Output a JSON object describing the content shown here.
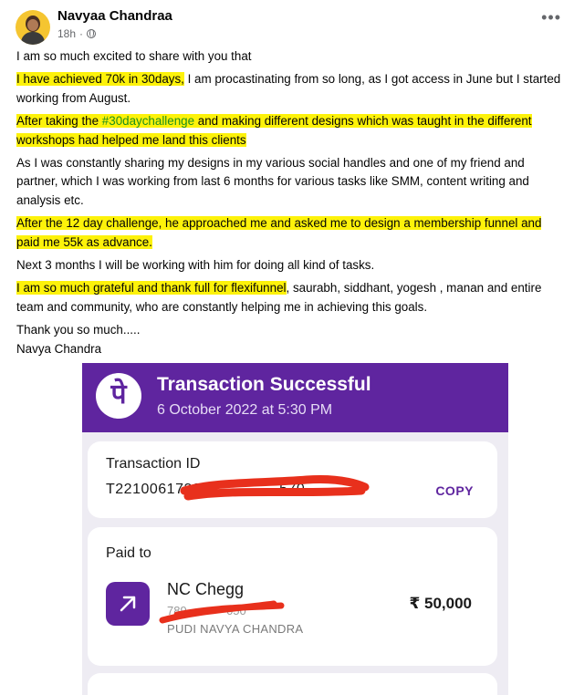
{
  "post": {
    "author": "Navyaa Chandraa",
    "time": "18h",
    "dot": "·",
    "more": "•••",
    "p1": "I am so much excited to share with you that",
    "p2_highlight": "I have achieved 70k in 30days,",
    "p2_rest": " I am procastinating from so long, as I got access in June but I started working from August.",
    "p3_a": "After taking the ",
    "p3_tag": "#30daychallenge",
    "p3_b": " and making different designs which was taught in the different workshops had helped me land this clients",
    "p4": "As I was constantly sharing my designs in my various social handles and one of my friend and partner, which I was working from last 6 months for various tasks like SMM, content writing and analysis etc.",
    "p5": "After the 12 day challenge, he approached me and asked me to design a membership funnel and paid me 55k as advance.",
    "p6": "Next 3 months I will be working with him for doing all kind of tasks.",
    "p7_highlight": "I am so much grateful and thank full for flexifunnel",
    "p7_rest": ", saurabh, siddhant, yogesh , manan and entire team and community, who are constantly helping me in achieving this goals.",
    "p8": "Thank you so much.....",
    "p9": "Navya Chandra"
  },
  "payment": {
    "logo": "पे",
    "title": "Transaction Successful",
    "date": "6 October 2022 at 5:30 PM",
    "txn_label": "Transaction ID",
    "txn_id_visible": "T221006173030",
    "txn_id_tail": "570",
    "copy": "COPY",
    "paid_to_label": "Paid to",
    "payee": "NC Chegg",
    "phone_visible": "789",
    "phone_tail": "050",
    "upi_name": "PUDI NAVYA CHANDRA",
    "amount": "₹ 50,000"
  },
  "icons": {
    "avatar": "profile-photo",
    "privacy": "globe-icon",
    "arrow": "arrow-up-right-icon"
  },
  "colors": {
    "highlight": "#fdf20a",
    "phonepe_purple": "#5f259f",
    "hashtag": "#1c8f1c",
    "redaction": "#e8301c"
  }
}
